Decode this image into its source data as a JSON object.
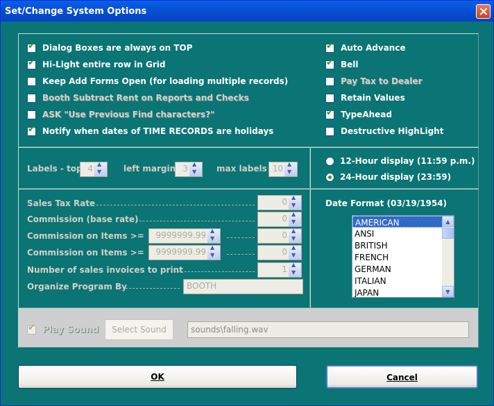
{
  "window": {
    "title": "Set/Change System Options"
  },
  "left_options": [
    {
      "label": "Dialog Boxes are always on TOP",
      "checked": true,
      "enabled": true
    },
    {
      "label": "Hi-Light entire row in Grid",
      "checked": true,
      "enabled": true
    },
    {
      "label": "Keep Add Forms Open (for loading multiple records)",
      "checked": false,
      "enabled": true
    },
    {
      "label": "Booth Subtract Rent on Reports and Checks",
      "checked": false,
      "enabled": false
    },
    {
      "label": "ASK \"Use Previous Find characters?\"",
      "checked": false,
      "enabled": false
    },
    {
      "label": "Notify when dates of TIME RECORDS are holidays",
      "checked": true,
      "enabled": true
    }
  ],
  "right_options": [
    {
      "label": "Auto Advance",
      "checked": true,
      "enabled": true
    },
    {
      "label": "Bell",
      "checked": true,
      "enabled": true
    },
    {
      "label": "Pay Tax to Dealer",
      "checked": false,
      "enabled": false
    },
    {
      "label": "Retain Values",
      "checked": false,
      "enabled": true
    },
    {
      "label": "TypeAhead",
      "checked": true,
      "enabled": true
    },
    {
      "label": "Destructive HighLight",
      "checked": false,
      "enabled": true
    }
  ],
  "labels": {
    "top_label": "Labels - top",
    "top_value": "4",
    "left_label": "left margin",
    "left_value": "3",
    "max_label": "max labels",
    "max_value": "10"
  },
  "time_display": [
    {
      "label": "12-Hour display (11:59 p.m.)",
      "selected": false
    },
    {
      "label": "24-Hour display (23:59)",
      "selected": true
    }
  ],
  "sales": {
    "tax_rate_label": "Sales Tax Rate",
    "tax_rate_value": "0",
    "commission_base_label": "Commission (base rate)",
    "commission_base_value": "0",
    "commission1_label": "Commission on Items >=",
    "commission1_amount": "9999999.99",
    "commission1_value": "0",
    "commission2_label": "Commission on Items >=",
    "commission2_amount": "9999999.99",
    "commission2_value": "0",
    "invoices_label": "Number of sales invoices to print",
    "invoices_value": "1",
    "organize_label": "Organize Program By",
    "organize_value": "BOOTH"
  },
  "date_format": {
    "label": "Date Format (03/19/1954)",
    "options": [
      "AMERICAN",
      "ANSI",
      "BRITISH",
      "FRENCH",
      "GERMAN",
      "ITALIAN",
      "JAPAN"
    ],
    "selected": "AMERICAN"
  },
  "sound": {
    "play_label": "Play Sound",
    "play_checked": true,
    "select_label": "Select Sound",
    "path": "sounds\\falling.wav"
  },
  "buttons": {
    "ok": "OK",
    "cancel": "Cancel"
  }
}
